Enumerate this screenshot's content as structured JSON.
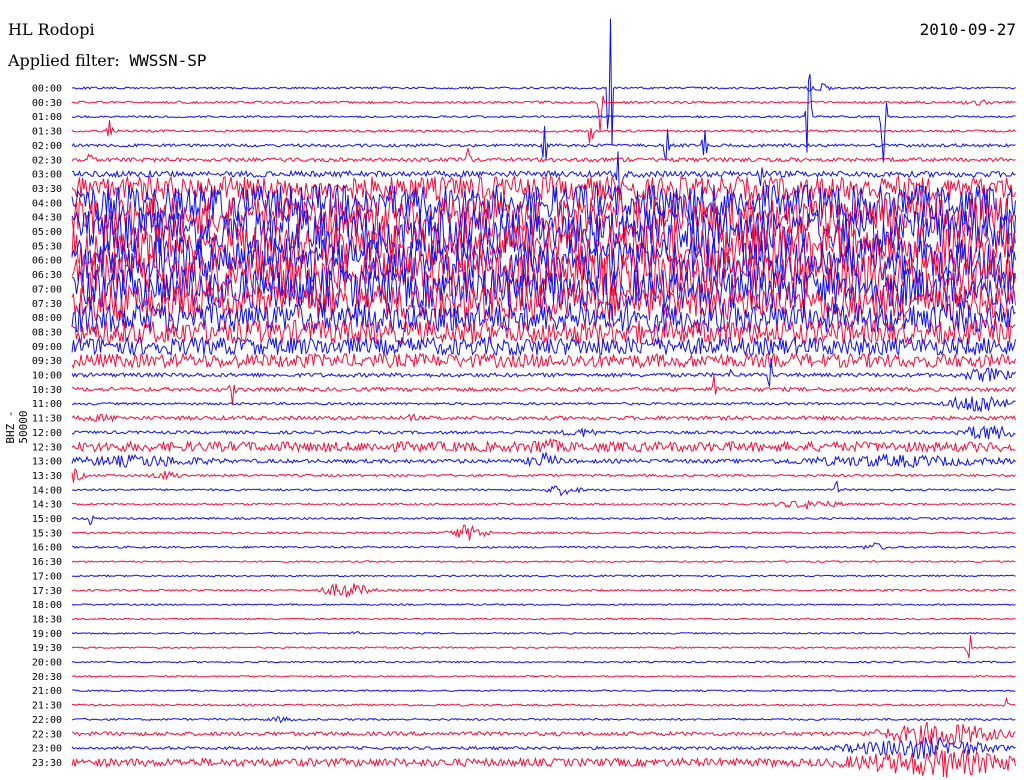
{
  "header": {
    "station": "HL Rodopi",
    "filter_label": "Applied filter:",
    "filter_name": "WWSSN-SP",
    "date": "2010-09-27"
  },
  "side_label": "BHZ - 50000",
  "colors": {
    "trace_a": "#1010e8",
    "trace_b": "#f0103c",
    "background": "#ffffff"
  },
  "chart_data": {
    "type": "line",
    "subtype": "helicorder",
    "rows": [
      {
        "time": "00:00",
        "amp": 1,
        "events": [
          {
            "pos": 0.57,
            "amp": 130
          },
          {
            "pos": 0.79,
            "amp": 6,
            "width": 0.02
          }
        ]
      },
      {
        "time": "00:30",
        "amp": 1.2,
        "events": [
          {
            "pos": 0.56,
            "amp": 45
          },
          {
            "pos": 0.96,
            "amp": 3,
            "width": 0.04
          }
        ]
      },
      {
        "time": "01:00",
        "amp": 1,
        "events": [
          {
            "pos": 0.78,
            "amp": 80
          },
          {
            "pos": 0.86,
            "amp": 100
          }
        ]
      },
      {
        "time": "01:30",
        "amp": 1.2,
        "events": [
          {
            "pos": 0.04,
            "amp": 20
          },
          {
            "pos": 0.55,
            "amp": 25
          }
        ]
      },
      {
        "time": "02:00",
        "amp": 1.5,
        "events": [
          {
            "pos": 0.5,
            "amp": 35
          },
          {
            "pos": 0.63,
            "amp": 40
          },
          {
            "pos": 0.67,
            "amp": 20
          }
        ]
      },
      {
        "time": "02:30",
        "amp": 2,
        "events": [
          {
            "pos": 0.02,
            "amp": 15
          },
          {
            "pos": 0.42,
            "amp": 22
          }
        ]
      },
      {
        "time": "03:00",
        "amp": 3,
        "events": [
          {
            "pos": 0.58,
            "amp": 50
          },
          {
            "pos": 0.73,
            "amp": 30
          }
        ]
      },
      {
        "time": "03:30",
        "amp": 12,
        "events": []
      },
      {
        "time": "04:00",
        "amp": 18,
        "events": []
      },
      {
        "time": "04:30",
        "amp": 20,
        "events": []
      },
      {
        "time": "05:00",
        "amp": 22,
        "events": []
      },
      {
        "time": "05:30",
        "amp": 22,
        "events": []
      },
      {
        "time": "06:00",
        "amp": 22,
        "events": []
      },
      {
        "time": "06:30",
        "amp": 22,
        "events": []
      },
      {
        "time": "07:00",
        "amp": 20,
        "events": []
      },
      {
        "time": "07:30",
        "amp": 18,
        "events": []
      },
      {
        "time": "08:00",
        "amp": 15,
        "events": []
      },
      {
        "time": "08:30",
        "amp": 12,
        "events": []
      },
      {
        "time": "09:00",
        "amp": 9,
        "events": []
      },
      {
        "time": "09:30",
        "amp": 7,
        "events": []
      },
      {
        "time": "10:00",
        "amp": 2,
        "events": [
          {
            "pos": 0.7,
            "amp": 18
          },
          {
            "pos": 0.74,
            "amp": 25
          },
          {
            "pos": 0.97,
            "amp": 8,
            "width": 0.05
          }
        ]
      },
      {
        "time": "10:30",
        "amp": 2,
        "events": [
          {
            "pos": 0.17,
            "amp": 20
          },
          {
            "pos": 0.68,
            "amp": 25
          }
        ]
      },
      {
        "time": "11:00",
        "amp": 1.2,
        "events": [
          {
            "pos": 0.96,
            "amp": 12,
            "width": 0.05
          }
        ]
      },
      {
        "time": "11:30",
        "amp": 2,
        "events": [
          {
            "pos": 0.03,
            "amp": 4,
            "width": 0.06
          },
          {
            "pos": 0.36,
            "amp": 10
          }
        ]
      },
      {
        "time": "12:00",
        "amp": 1.5,
        "events": [
          {
            "pos": 0.54,
            "amp": 5,
            "width": 0.04
          },
          {
            "pos": 0.97,
            "amp": 9,
            "width": 0.05
          }
        ]
      },
      {
        "time": "12:30",
        "amp": 5,
        "events": [
          {
            "pos": 0.5,
            "amp": 10,
            "width": 0.04
          }
        ]
      },
      {
        "time": "13:00",
        "amp": 2,
        "events": [
          {
            "pos": 0.07,
            "amp": 7,
            "width": 0.14
          },
          {
            "pos": 0.5,
            "amp": 9,
            "width": 0.03
          },
          {
            "pos": 0.87,
            "amp": 7,
            "width": 0.2
          }
        ]
      },
      {
        "time": "13:30",
        "amp": 1.2,
        "events": [
          {
            "pos": 0.0,
            "amp": 8,
            "width": 0.02
          },
          {
            "pos": 0.1,
            "amp": 5,
            "width": 0.03
          }
        ]
      },
      {
        "time": "14:00",
        "amp": 1,
        "events": [
          {
            "pos": 0.52,
            "amp": 6,
            "width": 0.03
          },
          {
            "pos": 0.81,
            "amp": 10
          }
        ]
      },
      {
        "time": "14:30",
        "amp": 1,
        "events": [
          {
            "pos": 0.78,
            "amp": 5,
            "width": 0.06
          }
        ]
      },
      {
        "time": "15:00",
        "amp": 1,
        "events": [
          {
            "pos": 0.02,
            "amp": 8
          }
        ]
      },
      {
        "time": "15:30",
        "amp": 1,
        "events": [
          {
            "pos": 0.42,
            "amp": 9,
            "width": 0.03
          }
        ]
      },
      {
        "time": "16:00",
        "amp": 1,
        "events": [
          {
            "pos": 0.85,
            "amp": 5,
            "width": 0.02
          }
        ]
      },
      {
        "time": "16:30",
        "amp": 0.8,
        "events": []
      },
      {
        "time": "17:00",
        "amp": 0.8,
        "events": []
      },
      {
        "time": "17:30",
        "amp": 1,
        "events": [
          {
            "pos": 0.29,
            "amp": 9,
            "width": 0.04
          }
        ]
      },
      {
        "time": "18:00",
        "amp": 0.8,
        "events": []
      },
      {
        "time": "18:30",
        "amp": 0.8,
        "events": []
      },
      {
        "time": "19:00",
        "amp": 0.8,
        "events": [
          {
            "pos": 0.3,
            "amp": 2,
            "width": 0.02
          }
        ]
      },
      {
        "time": "19:30",
        "amp": 0.8,
        "events": [
          {
            "pos": 0.95,
            "amp": 25
          }
        ]
      },
      {
        "time": "20:00",
        "amp": 0.8,
        "events": []
      },
      {
        "time": "20:30",
        "amp": 0.8,
        "events": []
      },
      {
        "time": "21:00",
        "amp": 0.8,
        "events": []
      },
      {
        "time": "21:30",
        "amp": 1,
        "events": [
          {
            "pos": 0.99,
            "amp": 10
          }
        ]
      },
      {
        "time": "22:00",
        "amp": 1,
        "events": [
          {
            "pos": 0.22,
            "amp": 3,
            "width": 0.03
          }
        ]
      },
      {
        "time": "22:30",
        "amp": 2,
        "events": [
          {
            "pos": 0.92,
            "amp": 14,
            "width": 0.1
          }
        ]
      },
      {
        "time": "23:00",
        "amp": 1.5,
        "events": [
          {
            "pos": 0.9,
            "amp": 12,
            "width": 0.12
          }
        ]
      },
      {
        "time": "23:30",
        "amp": 4,
        "events": [
          {
            "pos": 0.92,
            "amp": 16,
            "width": 0.16
          }
        ]
      }
    ]
  }
}
